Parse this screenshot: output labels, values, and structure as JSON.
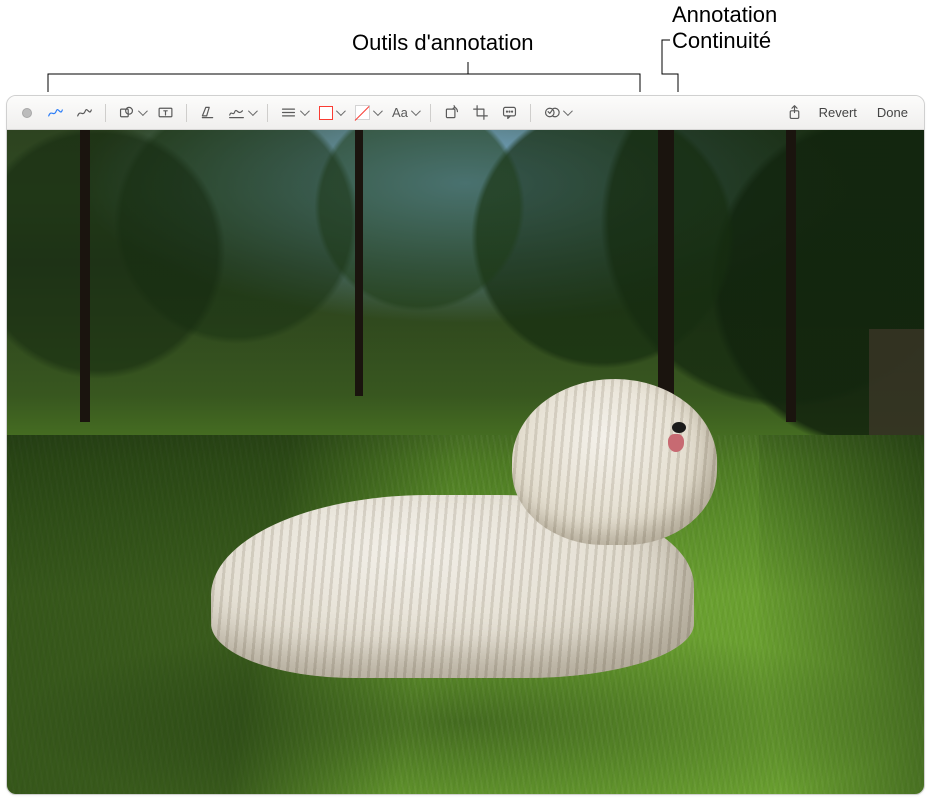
{
  "callouts": {
    "tools": "Outils d'annotation",
    "continuity_l1": "Annotation",
    "continuity_l2": "Continuité"
  },
  "toolbar": {
    "revert": "Revert",
    "done": "Done",
    "text_style": "Aa",
    "icons": {
      "close": "close-dot",
      "sketch": "sketch",
      "draw": "draw",
      "shapes": "shapes",
      "textbox": "textbox",
      "highlight": "highlight",
      "sign": "sign",
      "line_style": "line-style",
      "border_color": "border-color",
      "fill_color": "fill-color",
      "rotate": "rotate",
      "crop": "crop",
      "describe": "image-description",
      "continuity": "continuity-markup",
      "share": "share"
    },
    "colors": {
      "active_blue": "#2d7ef7",
      "border_red": "#fa3c33"
    }
  },
  "image": {
    "subject": "dog-on-grass"
  }
}
